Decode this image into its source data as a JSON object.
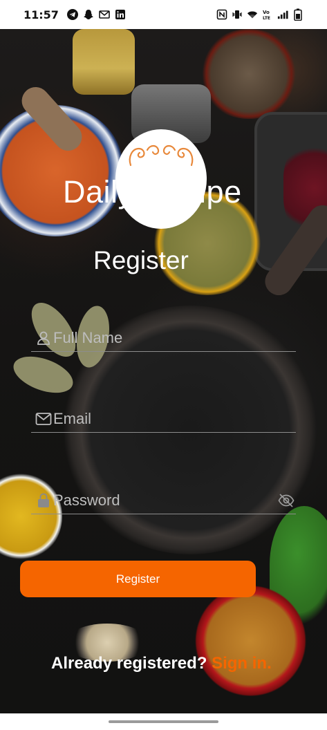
{
  "status_bar": {
    "time": "11:57",
    "left_icons": [
      "telegram-icon",
      "snapchat-icon",
      "gmail-icon",
      "linkedin-icon"
    ],
    "right_icons": [
      "nfc-icon",
      "vibrate-icon",
      "wifi-icon",
      "volte-icon",
      "signal-icon",
      "battery-icon"
    ]
  },
  "app": {
    "title": "Daily Recipe",
    "logo": "recipe-logo-icon"
  },
  "page": {
    "title": "Register"
  },
  "form": {
    "full_name": {
      "placeholder": "Full Name",
      "value": "",
      "icon": "person-icon"
    },
    "email": {
      "placeholder": "Email",
      "value": "",
      "icon": "mail-icon"
    },
    "password": {
      "placeholder": "Password",
      "value": "",
      "icon": "lock-icon",
      "toggle_icon": "eye-off-icon"
    },
    "submit_label": "Register"
  },
  "footer": {
    "prompt": "Already registered?",
    "link": "Sign in."
  },
  "colors": {
    "accent": "#f56500",
    "text": "#ffffff",
    "placeholder": "#bdbdbd"
  }
}
